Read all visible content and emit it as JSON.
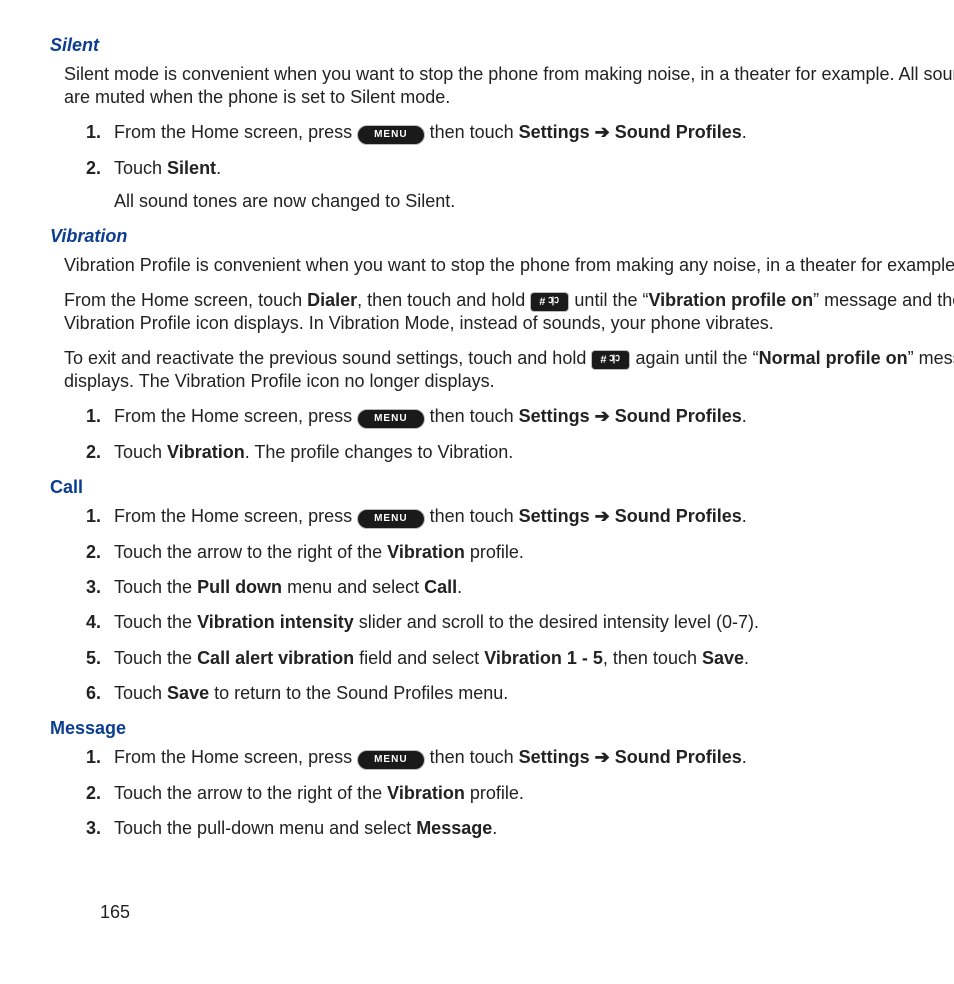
{
  "page_number": "165",
  "labels": {
    "menu": "MENU",
    "pound": "#"
  },
  "sections": {
    "silent": {
      "heading": "Silent",
      "intro": "Silent mode is convenient when you want to stop the phone from making noise, in a theater for example. All sounds are muted when the phone is set to Silent mode.",
      "s1_pre": "From the Home screen, press ",
      "s1_post1": " then touch ",
      "s1_b1": "Settings",
      "s1_arrow": " ➔ ",
      "s1_b2": "Sound Profiles",
      "s1_end": ".",
      "s2_pre": "Touch ",
      "s2_b": "Silent",
      "s2_end": ".",
      "s2_sub": "All sound tones are now changed to Silent."
    },
    "vibration": {
      "heading": "Vibration",
      "p1": "Vibration Profile is convenient when you want to stop the phone from making any noise, in a theater for example.",
      "p2_pre": "From the Home screen, touch ",
      "p2_b1": "Dialer",
      "p2_mid1": ", then touch and hold ",
      "p2_mid2": " until the “",
      "p2_b2": "Vibration profile on",
      "p2_mid3": "” message and the Vibration Profile icon displays. In Vibration Mode, instead of sounds, your phone vibrates.",
      "p3_pre": "To exit and reactivate the previous sound settings, touch and hold ",
      "p3_mid1": " again until the “",
      "p3_b1": "Normal profile on",
      "p3_mid2": "” message displays. The Vibration Profile icon no longer displays.",
      "s1_pre": "From the Home screen, press ",
      "s1_post1": " then touch ",
      "s1_b1": "Settings",
      "s1_arrow": " ➔ ",
      "s1_b2": "Sound Profiles",
      "s1_end": ".",
      "s2_pre": "Touch ",
      "s2_b": "Vibration",
      "s2_end": ". The profile changes to Vibration."
    },
    "call": {
      "heading": "Call",
      "s1_pre": "From the Home screen, press ",
      "s1_post1": " then touch ",
      "s1_b1": "Settings",
      "s1_arrow": " ➔ ",
      "s1_b2": "Sound Profiles",
      "s1_end": ".",
      "s2_pre": "Touch the arrow to the right of the ",
      "s2_b": "Vibration",
      "s2_end": " profile.",
      "s3_pre": "Touch the ",
      "s3_b1": "Pull down",
      "s3_mid": " menu and select ",
      "s3_b2": "Call",
      "s3_end": ".",
      "s4_pre": "Touch the ",
      "s4_b": "Vibration intensity",
      "s4_end": " slider and scroll to the desired intensity level (0-7).",
      "s5_pre": "Touch the ",
      "s5_b1": "Call alert vibration",
      "s5_mid1": " field and select ",
      "s5_b2": "Vibration 1 - 5",
      "s5_mid2": ", then touch ",
      "s5_b3": "Save",
      "s5_end": ".",
      "s6_pre": "Touch ",
      "s6_b": "Save",
      "s6_end": " to return to the Sound Profiles menu."
    },
    "message": {
      "heading": "Message",
      "s1_pre": "From the Home screen, press ",
      "s1_post1": " then touch ",
      "s1_b1": "Settings",
      "s1_arrow": " ➔ ",
      "s1_b2": "Sound Profiles",
      "s1_end": ".",
      "s2_pre": "Touch the arrow to the right of the ",
      "s2_b": "Vibration",
      "s2_end": " profile.",
      "s3_pre": "Touch the pull-down menu and select ",
      "s3_b": "Message",
      "s3_end": "."
    }
  }
}
